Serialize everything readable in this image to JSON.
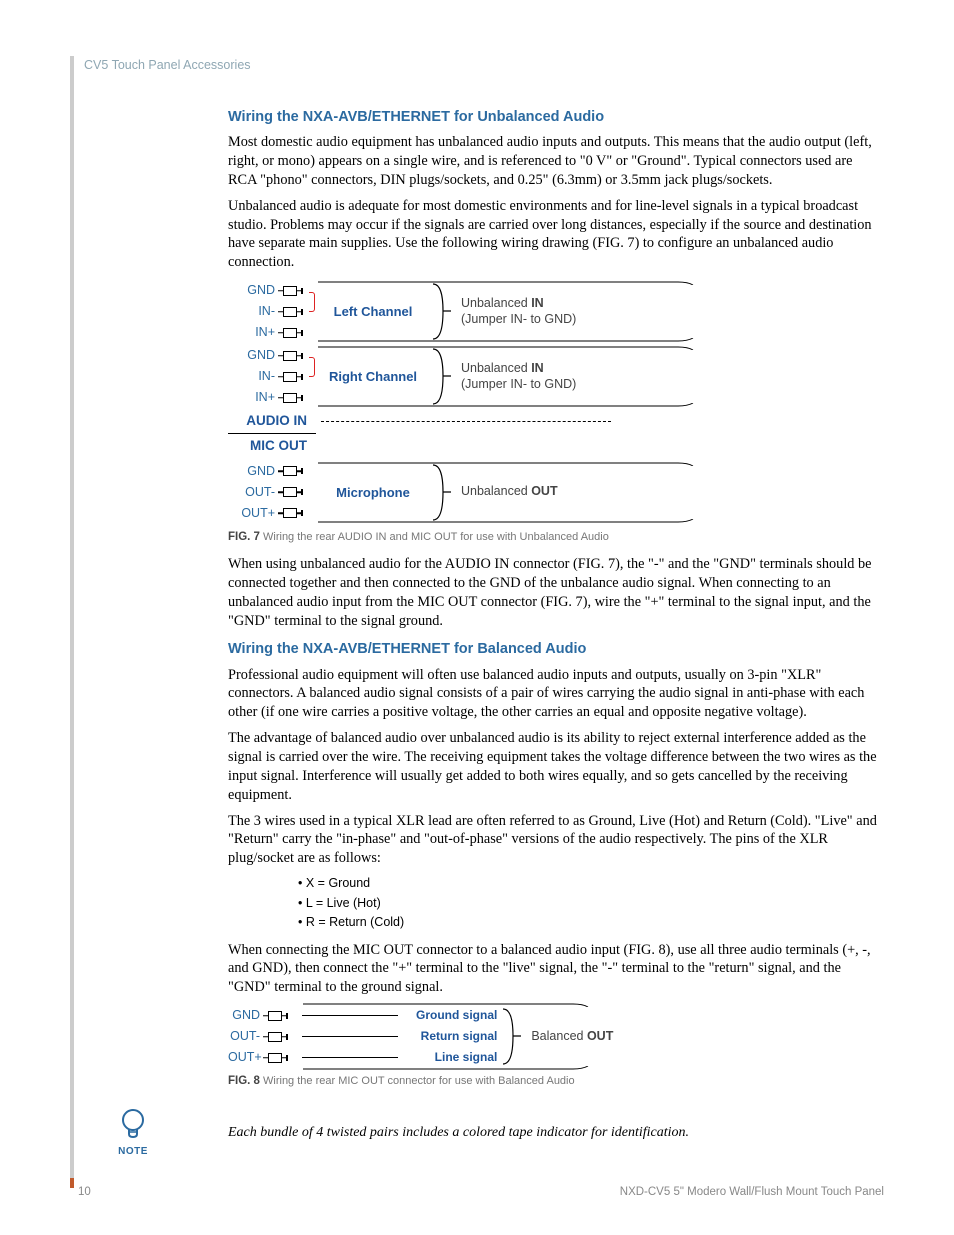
{
  "header": {
    "breadcrumb": "CV5 Touch Panel Accessories"
  },
  "section1": {
    "title": "Wiring the NXA-AVB/ETHERNET for Unbalanced Audio",
    "p1": "Most domestic audio equipment has unbalanced audio inputs and outputs. This means that the audio output (left, right, or mono) appears on a single wire, and is referenced to \"0 V\" or \"Ground\". Typical connectors used are RCA \"phono\" connectors, DIN plugs/sockets, and 0.25\" (6.3mm) or 3.5mm jack plugs/sockets.",
    "p2": "Unbalanced audio is adequate for most domestic environments and for line-level signals in a typical broadcast studio. Problems may occur if the signals are carried over long distances, especially if the source and destination have separate main supplies. Use the following wiring drawing (FIG. 7) to configure an unbalanced audio connection."
  },
  "fig7": {
    "pins_in1": [
      "GND",
      "IN-",
      "IN+"
    ],
    "pins_in2": [
      "GND",
      "IN-",
      "IN+"
    ],
    "pins_out": [
      "GND",
      "OUT-",
      "OUT+"
    ],
    "ch_left": "Left Channel",
    "ch_right": "Right Channel",
    "ch_mic": "Microphone",
    "audio_in": "AUDIO IN",
    "mic_out": "MIC OUT",
    "desc_in_a": "Unbalanced ",
    "desc_in_b": "IN",
    "desc_in_c": "(Jumper IN- to GND)",
    "desc_out_a": "Unbalanced ",
    "desc_out_b": "OUT",
    "caption_b": "FIG. 7",
    "caption": "  Wiring the rear AUDIO IN and MIC OUT for use with Unbalanced Audio"
  },
  "section1b": {
    "p3": "When using unbalanced audio for the AUDIO IN connector (FIG. 7), the \"-\" and the \"GND\" terminals should be connected together and then connected to the GND of the unbalance audio signal. When connecting to an unbalanced audio input from the MIC OUT connector (FIG. 7), wire the \"+\" terminal to the signal input, and the \"GND\" terminal to the signal ground."
  },
  "section2": {
    "title": "Wiring the NXA-AVB/ETHERNET for Balanced Audio",
    "p1": "Professional audio equipment will often use balanced audio inputs and outputs, usually on 3-pin \"XLR\" connectors. A balanced audio signal consists of a pair of wires carrying the audio signal in anti-phase with each other (if one wire carries a positive voltage, the other carries an equal and opposite negative voltage).",
    "p2": "The advantage of balanced audio over unbalanced audio is its ability to reject external interference added as the signal is carried over the wire. The receiving equipment takes the voltage difference between the two wires as the input signal. Interference will usually get added to both wires equally, and so gets cancelled by the receiving equipment.",
    "p3": "The 3 wires used in a typical XLR lead are often referred to as Ground, Live (Hot) and Return (Cold). \"Live\" and \"Return\" carry the \"in-phase\" and \"out-of-phase\" versions of the audio respectively. The pins of the XLR plug/socket are as follows:",
    "bullets": [
      "X = Ground",
      "L = Live (Hot)",
      "R = Return (Cold)"
    ],
    "p4": "When connecting the MIC OUT connector to a balanced audio input (FIG. 8), use all three audio terminals (+, -, and GND), then connect the \"+\" terminal to the \"live\" signal, the \"-\" terminal to the \"return\" signal, and the \"GND\" terminal to the ground signal."
  },
  "fig8": {
    "pins": [
      "GND",
      "OUT-",
      "OUT+"
    ],
    "sig": [
      "Ground signal",
      "Return signal",
      "Line signal"
    ],
    "desc_a": "Balanced ",
    "desc_b": "OUT",
    "caption_b": "FIG. 8",
    "caption": "  Wiring the rear MIC OUT connector for use with Balanced Audio"
  },
  "note": {
    "label": "NOTE",
    "text": "Each bundle of 4 twisted pairs includes a colored tape indicator for identification."
  },
  "footer": {
    "page": "10",
    "doc": "NXD-CV5 5\" Modero Wall/Flush Mount Touch Panel"
  }
}
